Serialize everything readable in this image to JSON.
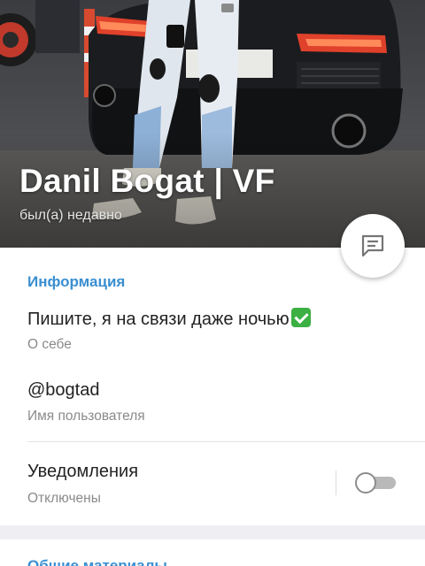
{
  "profile": {
    "name": "Danil Bogat | VF",
    "status": "был(а) недавно"
  },
  "info": {
    "section_title": "Информация",
    "bio": "Пишите, я на связи даже ночью",
    "bio_emoji": "check-mark-emoji",
    "bio_caption": "О себе",
    "username": "@bogtad",
    "username_caption": "Имя пользователя",
    "notifications_label": "Уведомления",
    "notifications_state": "Отключены",
    "notifications_enabled": false
  },
  "shared": {
    "section_title": "Общие материалы"
  },
  "icons": {
    "fab": "message-icon"
  },
  "colors": {
    "accent": "#3a8fd1",
    "emoji_green": "#3cb043"
  }
}
